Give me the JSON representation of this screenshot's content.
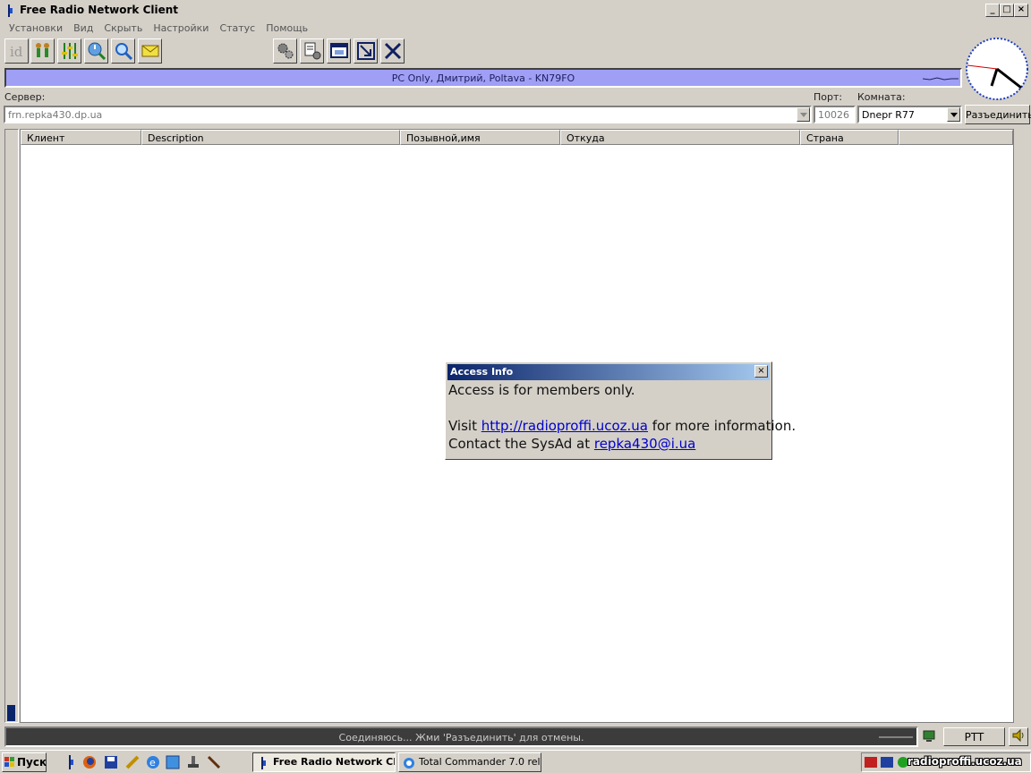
{
  "window": {
    "title": "Free Radio Network Client"
  },
  "menu": [
    "Установки",
    "Вид",
    "Скрыть",
    "Настройки",
    "Статус",
    "Помощь"
  ],
  "callsign_bar": {
    "text": "PC Only, Дмитрий, Poltava - KN79FO"
  },
  "connection": {
    "server_label": "Сервер:",
    "server_value": "frn.repka430.dp.ua",
    "port_label": "Порт:",
    "port_value": "10026",
    "room_label": "Комната:",
    "room_value": "Dnepr R77",
    "disconnect_label": "Разъединить"
  },
  "columns": [
    "Клиент",
    "Description",
    "Позывной,имя",
    "Откуда",
    "Страна"
  ],
  "dialog": {
    "title": "Access Info",
    "line1": "Access is for members only.",
    "visit_prefix": "Visit ",
    "visit_link": "http://radioproffi.ucoz.ua",
    "visit_suffix": " for more information.",
    "contact_prefix": "Contact the SysAd at ",
    "contact_link": "repka430@i.ua"
  },
  "status": {
    "text": "Соединяюсь... Жми 'Разъединить' для отмены.",
    "ptt_label": "PTT"
  },
  "taskbar": {
    "start_label": "Пуск",
    "tasks": [
      "Free Radio Network Cl...",
      "Total Commander 7.0 rel..."
    ],
    "watermark": "radioproffi.ucoz.ua"
  },
  "colors": {
    "callsign_bar": "#9f9ff6",
    "status_bar": "#3c3c3c",
    "dialog_title": "#0a246a"
  }
}
